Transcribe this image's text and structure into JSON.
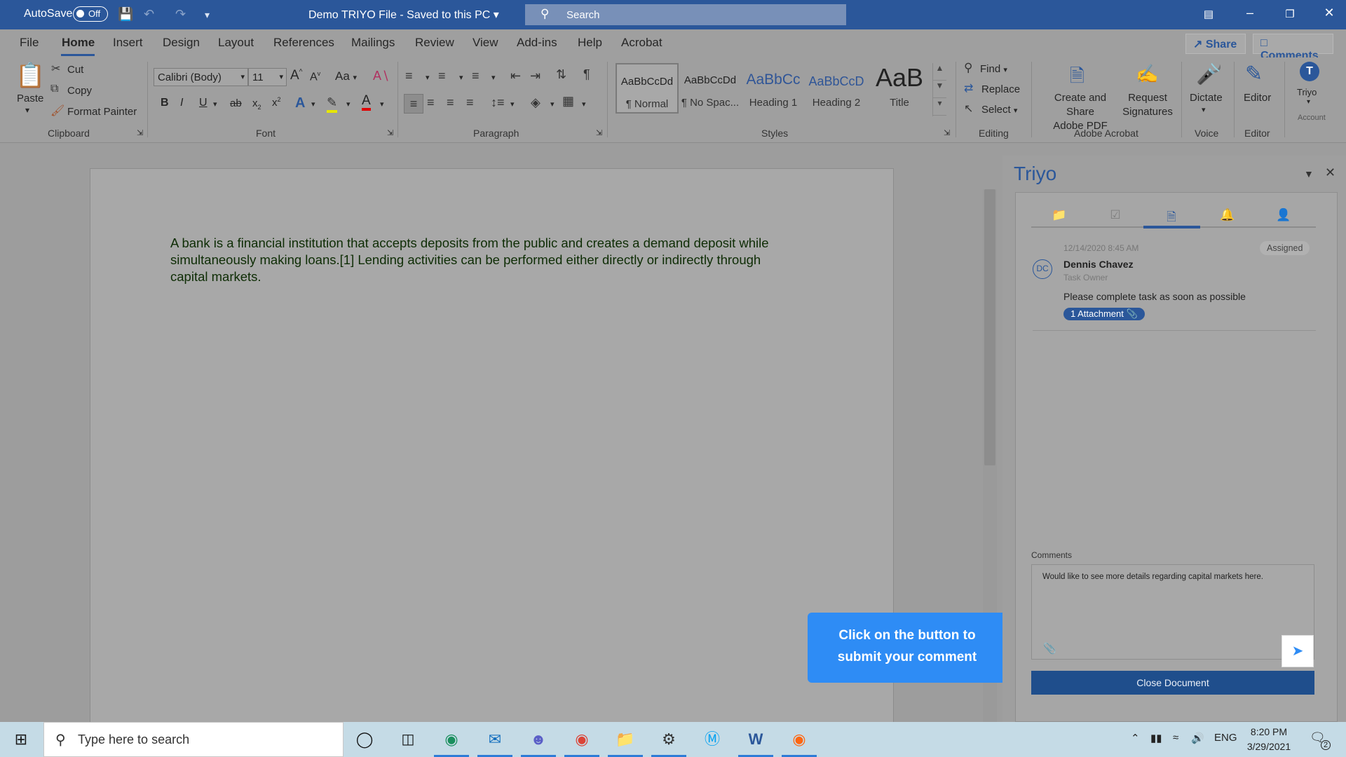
{
  "titlebar": {
    "autosave_label": "AutoSave",
    "autosave_state": "Off",
    "doc_title": "Demo TRIYO File  -  Saved to this PC",
    "search_placeholder": "Search"
  },
  "tabs": [
    "File",
    "Home",
    "Insert",
    "Design",
    "Layout",
    "References",
    "Mailings",
    "Review",
    "View",
    "Add-ins",
    "Help",
    "Acrobat"
  ],
  "active_tab": "Home",
  "share_label": "Share",
  "comments_label": "Comments",
  "clipboard": {
    "paste": "Paste",
    "cut": "Cut",
    "copy": "Copy",
    "format_painter": "Format Painter",
    "group": "Clipboard"
  },
  "font": {
    "family": "Calibri (Body)",
    "size": "11",
    "case_label": "Aa",
    "group": "Font",
    "bold": "B",
    "italic": "I",
    "underline": "U",
    "strike": "ab",
    "sub": "x",
    "sup": "x",
    "text_effects": "A",
    "font_color": "A",
    "grow": "A",
    "shrink": "A"
  },
  "paragraph": {
    "group": "Paragraph"
  },
  "styles": {
    "group": "Styles",
    "items": [
      {
        "preview": "AaBbCcDd",
        "name": "¶ Normal"
      },
      {
        "preview": "AaBbCcDd",
        "name": "¶ No Spac..."
      },
      {
        "preview": "AaBbCc",
        "name": "Heading 1"
      },
      {
        "preview": "AaBbCcD",
        "name": "Heading 2"
      },
      {
        "preview": "AaB",
        "name": "Title"
      }
    ]
  },
  "editing": {
    "find": "Find",
    "replace": "Replace",
    "select": "Select",
    "group": "Editing"
  },
  "acrobat": {
    "create_share_line1": "Create and Share",
    "create_share_line2": "Adobe PDF",
    "request_line1": "Request",
    "request_line2": "Signatures",
    "group": "Adobe Acrobat"
  },
  "voice": {
    "dictate": "Dictate",
    "group": "Voice"
  },
  "editor": {
    "label": "Editor",
    "group": "Editor"
  },
  "triyo_addin": {
    "label": "Triyo",
    "sub": "Account",
    "letter": "T"
  },
  "document": {
    "line1": "A bank is a financial institution that accepts deposits from the public and creates a demand deposit while",
    "line2": "simultaneously making loans.[1] Lending activities can be performed either directly or indirectly through",
    "line3": "capital markets."
  },
  "callout": {
    "line1": "Click on the button to",
    "line2": "submit your comment"
  },
  "pane": {
    "title": "Triyo",
    "task": {
      "date": "12/14/2020  8:45 AM",
      "status": "Assigned",
      "initials": "DC",
      "name": "Dennis Chavez",
      "role": "Task Owner",
      "message": "Please complete task as soon as possible",
      "attachment": "1 Attachment"
    },
    "comments_label": "Comments",
    "comment_text": "Would like to see more details regarding capital markets here.",
    "close_button": "Close Document"
  },
  "taskbar": {
    "search_placeholder": "Type here to search",
    "language": "ENG",
    "time": "8:20 PM",
    "date": "3/29/2021",
    "notifications": "2"
  },
  "colors": {
    "word_blue": "#2b579a",
    "callout_blue": "#2e8cf5",
    "close_button": "#1f4e8c"
  }
}
